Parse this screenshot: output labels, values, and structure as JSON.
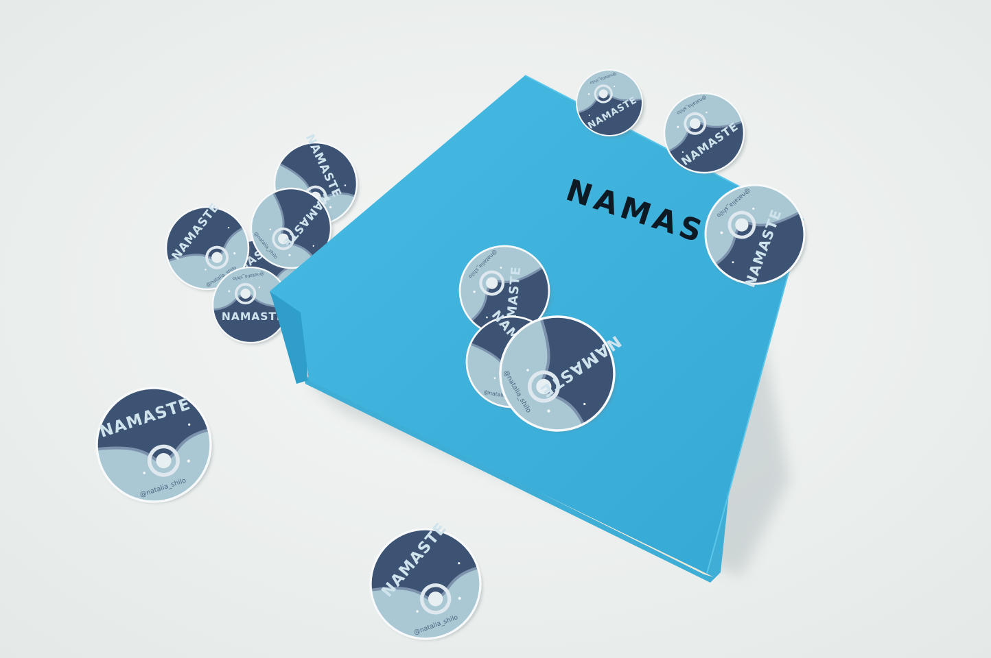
{
  "scene": {
    "background_color": "#eef1ef",
    "binder_color": "#3fb3dd",
    "binder_shadow_color": "#2f95bd",
    "pages_color": "#fbfbfd",
    "sticker_dark_color": "#3d5373",
    "sticker_light_color": "#a9c8d4"
  },
  "binder": {
    "cover_title": "NAMASTE"
  },
  "sticker": {
    "word": "NAMASTE",
    "handle": "@natalia_shilo"
  }
}
